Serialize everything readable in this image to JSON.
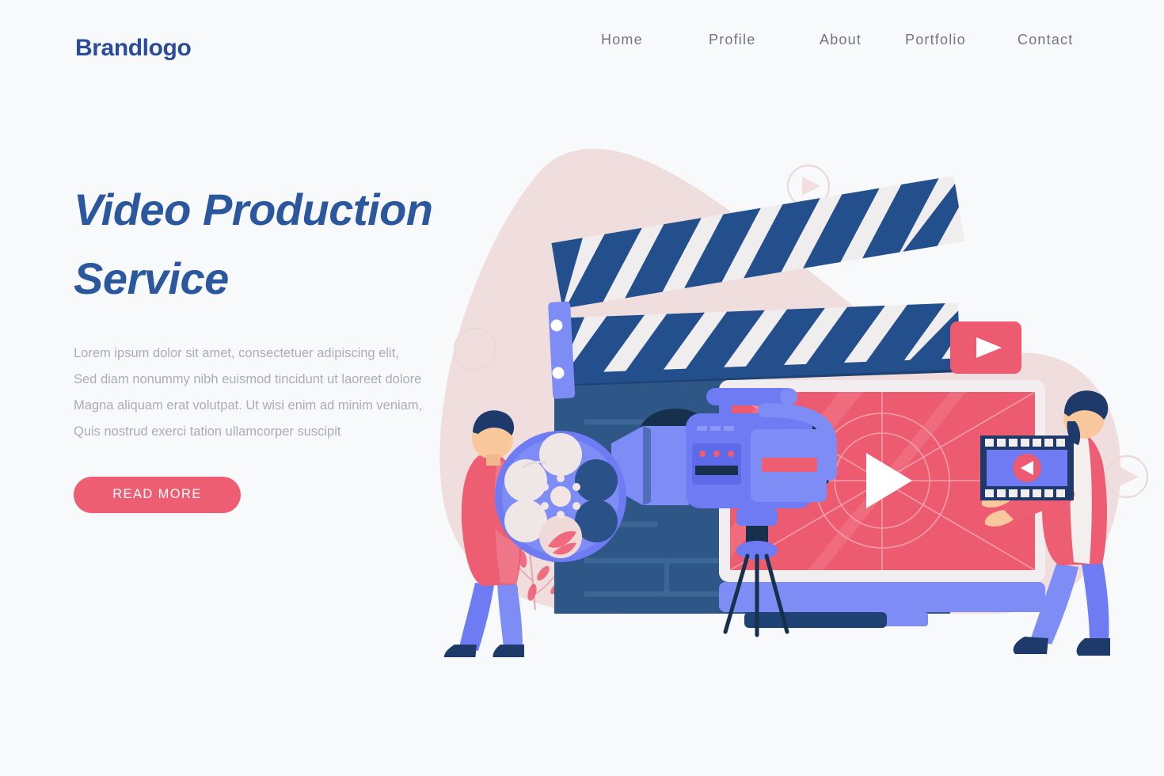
{
  "header": {
    "brand": "Brandlogo",
    "nav": [
      {
        "label": "Home"
      },
      {
        "label": "Profile"
      },
      {
        "label": "About"
      },
      {
        "label": "Portfolio"
      },
      {
        "label": "Contact"
      }
    ]
  },
  "hero": {
    "title_line1": "Video Production",
    "title_line2": "Service",
    "paragraph_lines": [
      "Lorem ipsum dolor sit amet, consectetuer adipiscing elit,",
      "Sed diam nonummy nibh euismod tincidunt ut laoreet dolore",
      "Magna aliquam erat volutpat. Ut wisi enim ad minim veniam,",
      "Quis nostrud exerci tation ullamcorper suscipit"
    ],
    "cta_label": "READ MORE"
  },
  "illustration": {
    "alt": "Flat illustration of video production: clapperboard, monitor with play button, video camera on tripod, two people carrying a film reel and a film strip",
    "elements": [
      "clapperboard",
      "monitor-screen",
      "play-button-large",
      "video-camera",
      "tripod",
      "film-reel",
      "film-strip",
      "person-left",
      "person-right",
      "youtube-play-badge",
      "floating-play-circle",
      "background-blob",
      "plant"
    ]
  },
  "colors": {
    "page_background": "#F8F9FB",
    "brand_blue": "#2B4C9B",
    "heading_blue": "#2B579E",
    "nav_gray": "#72767C",
    "body_gray": "#A9ADB4",
    "accent_pink": "#EE5E72",
    "accent_red": "#EC5B6F",
    "periwinkle": "#6E7BF2",
    "deep_navy": "#1E3A6B",
    "panel_blue": "#2E5687",
    "blob_pink": "#EFDCDC",
    "cream": "#F0ECEC"
  }
}
